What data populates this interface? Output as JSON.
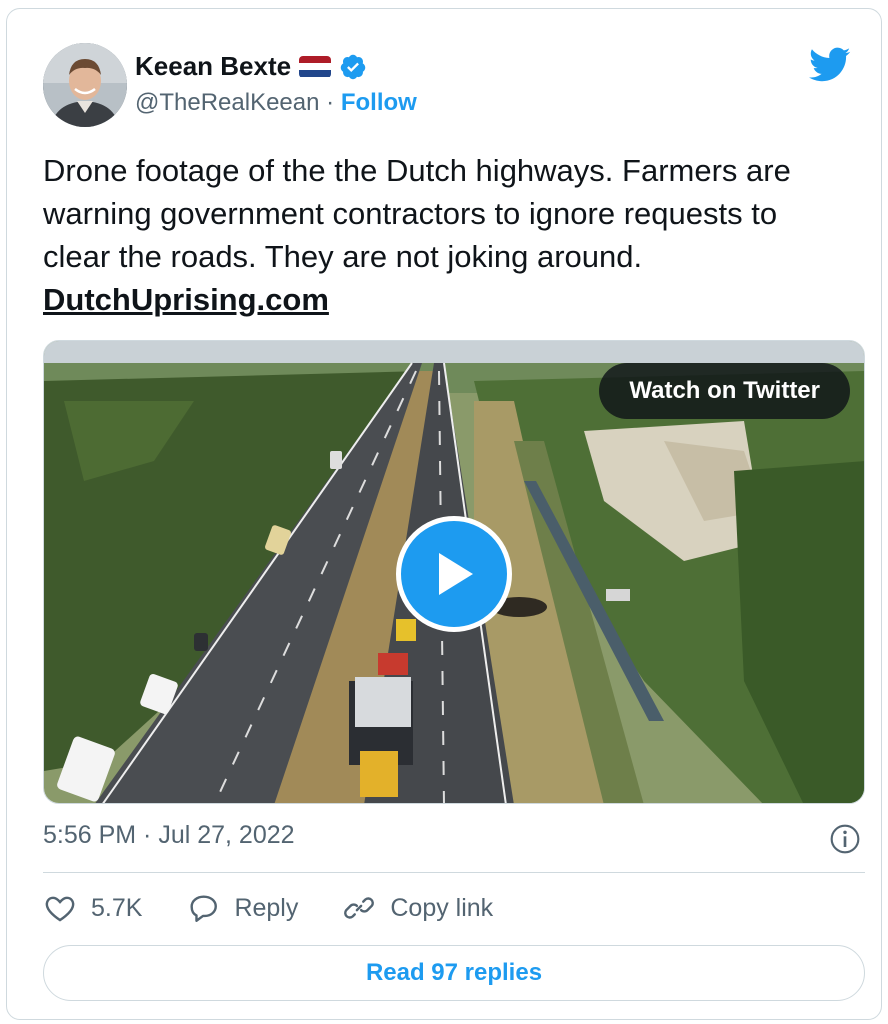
{
  "author": {
    "name": "Keean Bexte",
    "handle": "@TheRealKeean",
    "separator": "·",
    "follow_label": "Follow"
  },
  "tweet": {
    "text": "Drone footage of the the Dutch highways. Farmers are warning government contractors to ignore requests to clear the roads. They are not joking around.",
    "link_text": "DutchUprising.com"
  },
  "media": {
    "watch_label": "Watch on Twitter",
    "type": "video"
  },
  "meta": {
    "timestamp": "5:56 PM · Jul 27, 2022"
  },
  "actions": {
    "likes": "5.7K",
    "reply_label": "Reply",
    "copy_link_label": "Copy link"
  },
  "footer": {
    "read_replies_label": "Read 97 replies"
  },
  "colors": {
    "accent": "#1d9bf0",
    "text": "#0f1419",
    "secondary": "#536471",
    "border": "#cfd9de"
  },
  "icons": [
    "twitter-bird-icon",
    "verified-badge-icon",
    "netherlands-flag-icon",
    "play-icon",
    "info-icon",
    "heart-icon",
    "reply-icon",
    "link-icon"
  ]
}
